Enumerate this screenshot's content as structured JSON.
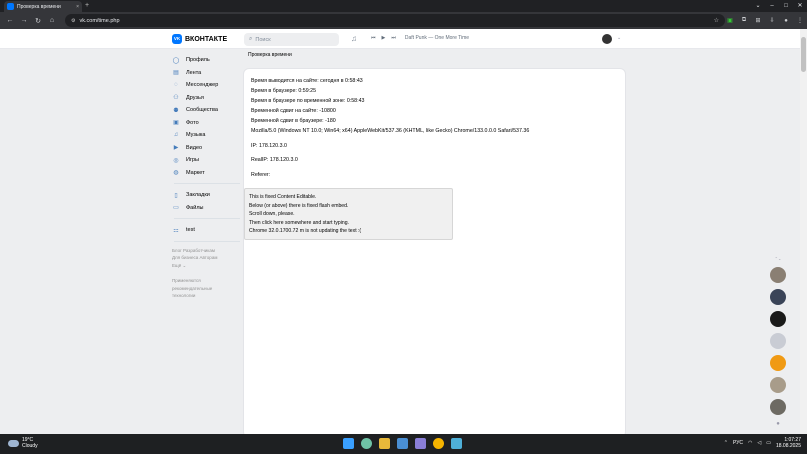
{
  "browser": {
    "tab_title": "Проверка времени",
    "tab_close": "×",
    "new_tab": "+",
    "url": "vk.com/time.php",
    "window_controls": [
      "⌄",
      "–",
      "□",
      "✕"
    ]
  },
  "vk_header": {
    "logo_text": "ВКОНТАКТЕ",
    "search_placeholder": "Поиск",
    "track": "Daft Punk — One More Time",
    "avatar_caret": "⌄"
  },
  "sidebar": {
    "items": [
      {
        "label": "Профиль",
        "icon": "user-icon",
        "glyph": "◯"
      },
      {
        "label": "Лента",
        "icon": "news-icon",
        "glyph": "▤"
      },
      {
        "label": "Мессенджер",
        "icon": "message-icon",
        "glyph": "◌"
      },
      {
        "label": "Друзья",
        "icon": "friends-icon",
        "glyph": "⚇"
      },
      {
        "label": "Сообщества",
        "icon": "groups-icon",
        "glyph": "⚉"
      },
      {
        "label": "Фото",
        "icon": "photo-icon",
        "glyph": "▣"
      },
      {
        "label": "Музыка",
        "icon": "music-icon",
        "glyph": "♫"
      },
      {
        "label": "Видео",
        "icon": "video-icon",
        "glyph": "▶"
      },
      {
        "label": "Игры",
        "icon": "games-icon",
        "glyph": "◎"
      },
      {
        "label": "Маркет",
        "icon": "market-icon",
        "glyph": "◍"
      }
    ],
    "items2": [
      {
        "label": "Закладки",
        "icon": "bookmark-icon",
        "glyph": "▯"
      },
      {
        "label": "Файлы",
        "icon": "files-icon",
        "glyph": "▭"
      }
    ],
    "items3": [
      {
        "label": "test",
        "icon": "app-icon",
        "glyph": "⚏"
      }
    ],
    "footer_line1": "Блог   Разработчикам",
    "footer_line2": "Для бизнеса   Авторам",
    "footer_line3": "Ещё ⌄",
    "footer_note1": "Применяются",
    "footer_note2": "рекомендательные",
    "footer_note3": "технологии"
  },
  "main": {
    "breadcrumb": "Проверка времени",
    "lines": [
      "Время выводится на сайте: сегодня в 0:58:43",
      "Время в браузере: 0:59:25",
      "Время в браузере по временной зоне: 0:58:43",
      "Временной сдвиг на сайте: -10800",
      "Временной сдвиг в браузере: -180"
    ],
    "user_agent": "Mozilla/5.0 (Windows NT 10.0; Win64; x64) AppleWebKit/537.36 (KHTML, like Gecko) Chrome/133.0.0.0 Safari/537.36",
    "ip": "IP: 178.120.3.0",
    "real_ip": "RealIP: 178.120.3.0",
    "referer": "Referer:",
    "content_editable": [
      "This is fixed Content Editable.",
      "Below (or above) there is fixed flash embed.",
      "Scroll down, please.",
      "Then click here somewhere and start typing.",
      "Chrome 32.0.1700.72 m is not updating the text :("
    ]
  },
  "right_bar": {
    "top": "⌃⌄",
    "avatars": [
      "#8a7f73",
      "#3a4458",
      "#1a1a1a",
      "#c9ccd4",
      "#f09a14",
      "#a89c8a",
      "#6d6a63"
    ]
  },
  "taskbar": {
    "temperature": "19°C",
    "weather": "Cloudy",
    "lang": "РУС",
    "time": "1:07:27",
    "date": "18.08.2025"
  },
  "colors": {
    "accent": "#0077ff",
    "link": "#447bba"
  }
}
